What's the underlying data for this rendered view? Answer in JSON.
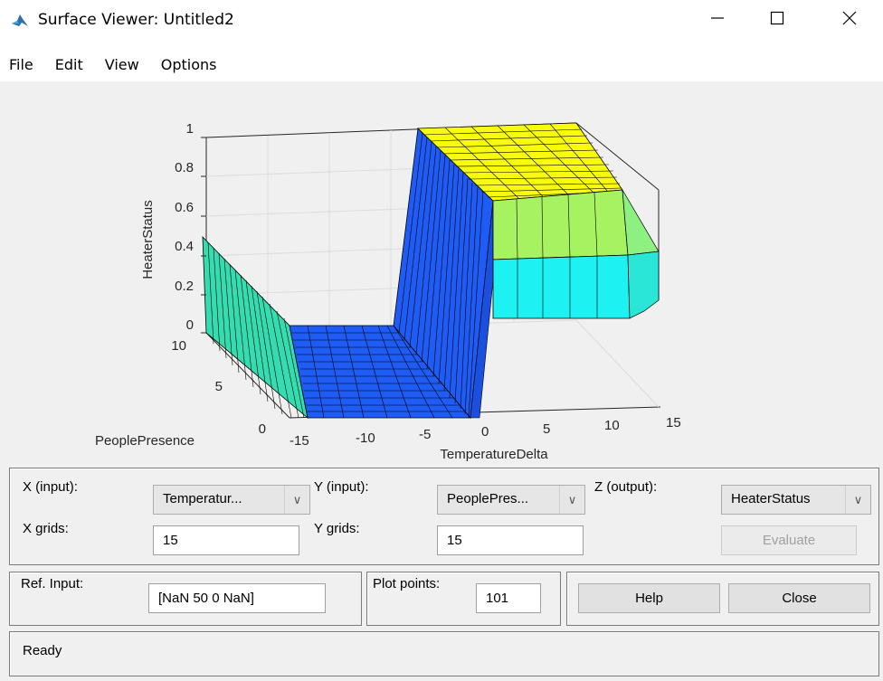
{
  "window": {
    "title": "Surface Viewer: Untitled2"
  },
  "menu": [
    "File",
    "Edit",
    "View",
    "Options"
  ],
  "plot": {
    "zlabel": "HeaterStatus",
    "xlabel": "TemperatureDelta",
    "ylabel": "PeoplePresence",
    "z_ticks": [
      "1",
      "0.8",
      "0.6",
      "0.4",
      "0.2",
      "0"
    ],
    "x_ticks": [
      "-15",
      "-10",
      "-5",
      "0",
      "5",
      "10",
      "15"
    ],
    "y_ticks": [
      "10",
      "5",
      "0"
    ],
    "colors": {
      "yellow": "#f9fb0e",
      "green_yellow": "#a6f260",
      "cyan": "#1ef1f1",
      "blue": "#1e5cf5",
      "teal": "#34dcb0"
    }
  },
  "controls": {
    "x_input_label": "X (input):",
    "x_input_value": "Temperatur...",
    "y_input_label": "Y (input):",
    "y_input_value": "PeoplePres...",
    "z_output_label": "Z (output):",
    "z_output_value": "HeaterStatus",
    "x_grids_label": "X grids:",
    "x_grids_value": "15",
    "y_grids_label": "Y grids:",
    "y_grids_value": "15",
    "evaluate_label": "Evaluate",
    "ref_input_label": "Ref. Input:",
    "ref_input_value": "[NaN 50 0 NaN]",
    "plot_points_label": "Plot points:",
    "plot_points_value": "101",
    "help_label": "Help",
    "close_label": "Close"
  },
  "status": {
    "text": "Ready"
  }
}
